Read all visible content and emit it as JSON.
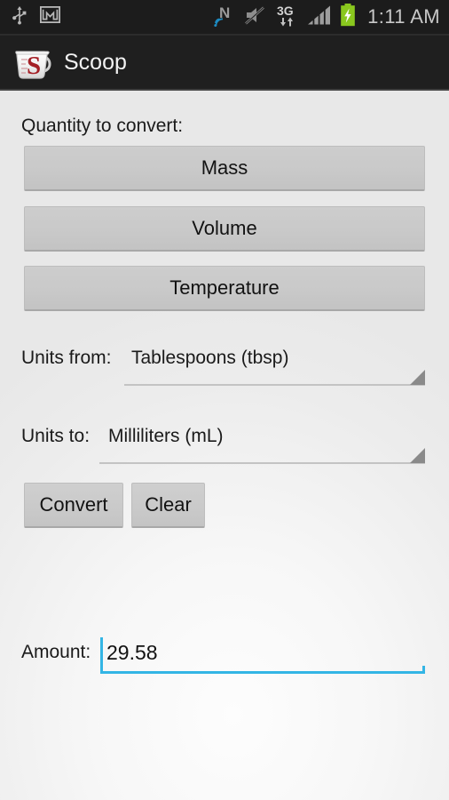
{
  "status_bar": {
    "left_icons": [
      {
        "name": "usb-icon",
        "label": "USB connected"
      },
      {
        "name": "gmail-icon",
        "label": "Gmail notification"
      }
    ],
    "right_icons": [
      {
        "name": "nfc-icon",
        "label": "N"
      },
      {
        "name": "mute-icon",
        "label": "Sound muted"
      },
      {
        "name": "network-3g-icon",
        "label": "3G"
      },
      {
        "name": "signal-bars-icon",
        "label": "Signal strength"
      },
      {
        "name": "battery-charging-icon",
        "label": "Battery charging"
      }
    ],
    "network_type": "3G",
    "nfc_letter": "N",
    "clock": "1:11 AM",
    "colors": {
      "background": "#1c1c1c",
      "battery": "#8ac81e",
      "nfc_wave": "#1d8ac0",
      "text": "#c8c8c8"
    }
  },
  "action_bar": {
    "app_title": "Scoop",
    "icon_name": "measuring-cup-icon",
    "icon_letter": "S",
    "colors": {
      "background": "#1f1f1f",
      "title": "#f2f2f2",
      "cup_letter": "#a41f26"
    }
  },
  "main": {
    "quantity_section_label": "Quantity to convert:",
    "quantity_buttons": [
      {
        "label": "Mass",
        "name": "mass-button"
      },
      {
        "label": "Volume",
        "name": "volume-button"
      },
      {
        "label": "Temperature",
        "name": "temperature-button"
      }
    ],
    "units_from": {
      "label": "Units from:",
      "value": "Tablespoons (tbsp)"
    },
    "units_to": {
      "label": "Units to:",
      "value": "Milliliters (mL)"
    },
    "actions": [
      {
        "label": "Convert",
        "name": "convert-button"
      },
      {
        "label": "Clear",
        "name": "clear-button"
      }
    ],
    "amount": {
      "label": "Amount:",
      "value": "29.58",
      "placeholder": "",
      "focused": true,
      "accent_color": "#33b5e5"
    },
    "colors": {
      "text": "#1a1a1a",
      "button_face": "#c9c9c9",
      "spinner_line": "#c3c3c3",
      "spinner_arrow": "#8a8a8a"
    }
  }
}
